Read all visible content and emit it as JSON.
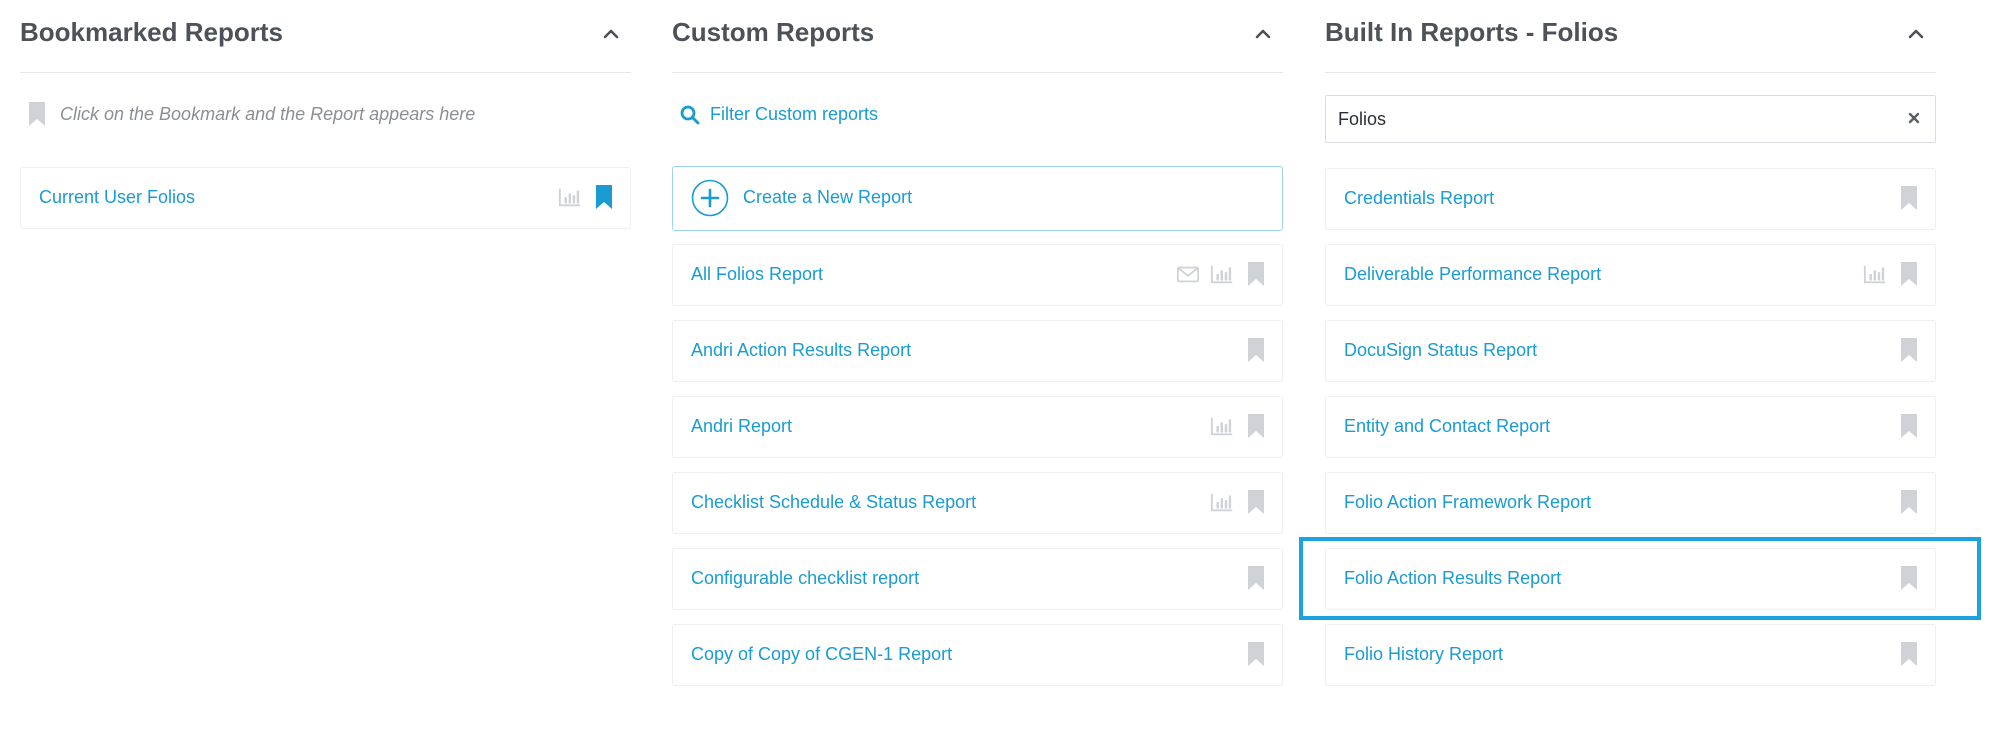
{
  "colors": {
    "accent": "#1a9bd1",
    "title": "#4d5258",
    "muted": "#cfd3d7",
    "highlight": "#1aa3e0"
  },
  "bookmarked": {
    "title": "Bookmarked Reports",
    "hint": "Click on the Bookmark and the Report appears here",
    "items": [
      {
        "label": "Current User Folios",
        "icons": [
          "chart-icon",
          "bookmark-filled-icon"
        ]
      }
    ]
  },
  "custom": {
    "title": "Custom Reports",
    "filter_label": "Filter Custom reports",
    "new_report_label": "Create a New Report",
    "items": [
      {
        "label": "All Folios Report",
        "icons": [
          "envelope-icon",
          "chart-icon",
          "bookmark-icon"
        ]
      },
      {
        "label": "Andri Action Results Report",
        "icons": [
          "bookmark-icon"
        ]
      },
      {
        "label": "Andri Report",
        "icons": [
          "chart-icon",
          "bookmark-icon"
        ]
      },
      {
        "label": "Checklist Schedule & Status Report",
        "icons": [
          "chart-icon",
          "bookmark-icon"
        ]
      },
      {
        "label": "Configurable checklist report",
        "icons": [
          "bookmark-icon"
        ]
      },
      {
        "label": "Copy of Copy of CGEN-1 Report",
        "icons": [
          "bookmark-icon"
        ]
      }
    ]
  },
  "builtin": {
    "title": "Built In Reports - Folios",
    "search_value": "Folios",
    "items": [
      {
        "label": "Credentials Report",
        "icons": [
          "bookmark-icon"
        ]
      },
      {
        "label": "Deliverable Performance Report",
        "icons": [
          "chart-icon",
          "bookmark-icon"
        ]
      },
      {
        "label": "DocuSign Status Report",
        "icons": [
          "bookmark-icon"
        ]
      },
      {
        "label": "Entity and Contact Report",
        "icons": [
          "bookmark-icon"
        ]
      },
      {
        "label": "Folio Action Framework Report",
        "icons": [
          "bookmark-icon"
        ]
      },
      {
        "label": "Folio Action Results Report",
        "icons": [
          "bookmark-icon"
        ]
      },
      {
        "label": "Folio History Report",
        "icons": [
          "bookmark-icon"
        ]
      }
    ]
  }
}
